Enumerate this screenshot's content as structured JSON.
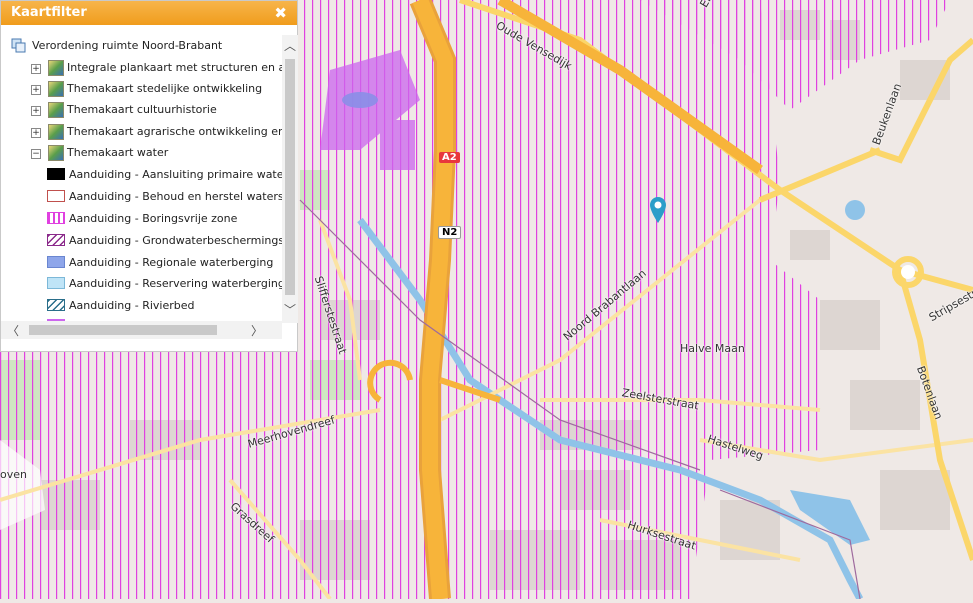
{
  "panel": {
    "title": "Kaartfilter",
    "close_symbol": "✖",
    "root_label": "Verordening ruimte Noord-Brabant",
    "themes": [
      {
        "label": "Integrale plankaart met structuren en aand",
        "state": "+"
      },
      {
        "label": "Themakaart stedelijke ontwikkeling",
        "state": "+"
      },
      {
        "label": "Themakaart cultuurhistorie",
        "state": "+"
      },
      {
        "label": "Themakaart agrarische ontwikkeling en win",
        "state": "+"
      },
      {
        "label": "Themakaart water",
        "state": "−"
      }
    ],
    "legend": [
      {
        "label": "Aanduiding - Aansluiting primaire waterker",
        "symbol": "solid-black"
      },
      {
        "label": "Aanduiding - Behoud en herstel watersyster",
        "symbol": "outline-red"
      },
      {
        "label": "Aanduiding - Boringsvrije zone",
        "symbol": "magenta-vertical-hatch"
      },
      {
        "label": "Aanduiding - Grondwaterbeschermingsgebie",
        "symbol": "purple-diagonal-hatch"
      },
      {
        "label": "Aanduiding - Regionale waterberging",
        "symbol": "blue-fill"
      },
      {
        "label": "Aanduiding - Reservering waterberging",
        "symbol": "light-blue-fill"
      },
      {
        "label": "Aanduiding - Rivierbed",
        "symbol": "teal-diagonal-hatch"
      }
    ],
    "scroll": {
      "up": "︿",
      "down": "﹀",
      "left": "〈",
      "right": "〉"
    }
  },
  "map": {
    "road_shields": [
      {
        "text": "A2",
        "color": "#e8373c"
      },
      {
        "text": "N2",
        "color": "#ffffff"
      }
    ],
    "street_labels": [
      "Oude Vensedijk",
      "Eh",
      "Beukenlaan",
      "Noord Brabantlaan",
      "Slifferstestraat",
      "Halve Maan",
      "Zeelsterstraat",
      "Meerhovendreef",
      "Hastelweg",
      "Stripsestr",
      "Botenlaan",
      "Grasdreef",
      "Hurksestraat",
      "oven"
    ],
    "colors": {
      "background": "#efe9e6",
      "boringsvrije_hatch": "#e040e0",
      "motorway": "#f7b43a",
      "primary": "#fbd66a",
      "water": "#8fc3e8",
      "panel_header": "#f3a52a"
    },
    "marker_icon": "map-pin-icon"
  }
}
